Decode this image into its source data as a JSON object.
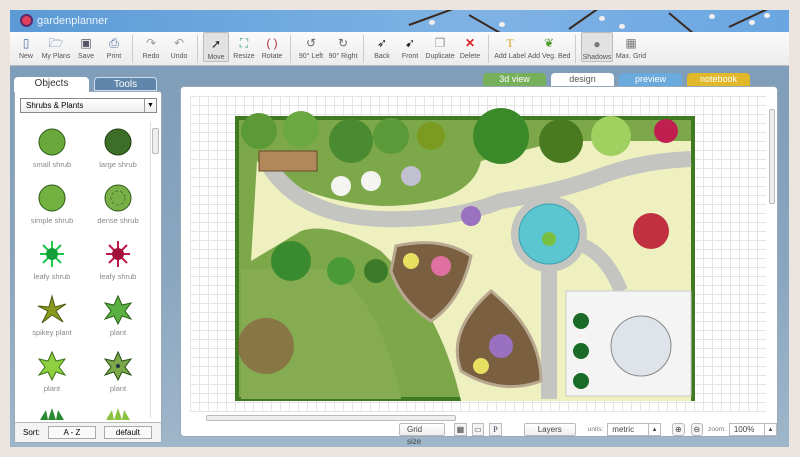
{
  "app": {
    "logo_text": "gardenplanner"
  },
  "toolbar": [
    {
      "label": "New",
      "icon": "new-file-icon"
    },
    {
      "label": "My Plans",
      "icon": "folder-icon"
    },
    {
      "label": "Save",
      "icon": "save-icon"
    },
    {
      "label": "Print",
      "icon": "print-icon"
    },
    {
      "label": "Redo",
      "icon": "redo-icon"
    },
    {
      "label": "Undo",
      "icon": "undo-icon"
    },
    {
      "label": "Move",
      "icon": "cursor-icon"
    },
    {
      "label": "Resize",
      "icon": "resize-icon"
    },
    {
      "label": "Rotate",
      "icon": "rotate-icon"
    },
    {
      "label": "90° Left",
      "icon": "rotate-left-icon"
    },
    {
      "label": "90° Right",
      "icon": "rotate-right-icon"
    },
    {
      "label": "Back",
      "icon": "send-back-icon"
    },
    {
      "label": "Front",
      "icon": "bring-front-icon"
    },
    {
      "label": "Duplicate",
      "icon": "duplicate-icon"
    },
    {
      "label": "Delete",
      "icon": "delete-icon"
    },
    {
      "label": "Add Label",
      "icon": "text-label-icon"
    },
    {
      "label": "Add Veg. Bed",
      "icon": "veg-bed-icon"
    },
    {
      "label": "Shadows",
      "icon": "shadows-icon"
    },
    {
      "label": "Max. Grid",
      "icon": "max-grid-icon"
    }
  ],
  "view_tabs": [
    {
      "label": "3d view",
      "color": "#77b05a"
    },
    {
      "label": "design",
      "color": "#ffffff"
    },
    {
      "label": "preview",
      "color": "#6aaadc"
    },
    {
      "label": "notebook",
      "color": "#e0b82a"
    }
  ],
  "left_panel": {
    "tabs": [
      "Objects",
      "Tools"
    ],
    "category": "Shrubs & Plants",
    "objects": [
      "small shrub",
      "large shrub",
      "simple shrub",
      "dense shrub",
      "leafy shrub",
      "leafy shrub",
      "spikey plant",
      "plant",
      "plant",
      "plant"
    ],
    "sort_label": "Sort:",
    "sort_buttons": [
      "A - Z",
      "default"
    ]
  },
  "bottom_bar": {
    "grid_size": "Grid size",
    "p_button": "P",
    "layers": "Layers",
    "units_label": "units:",
    "units_value": "metric",
    "zoom_label": "zoom:",
    "zoom_value": "100%"
  }
}
